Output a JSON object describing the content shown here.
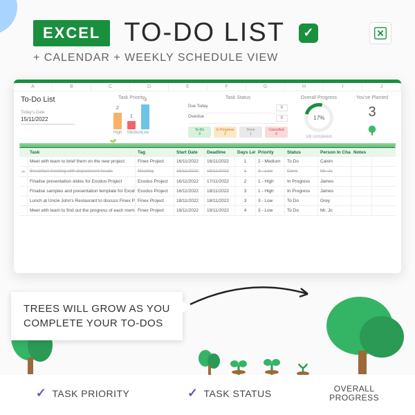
{
  "header": {
    "badge": "EXCEL",
    "title": "TO-DO LIST",
    "subtitle": "+ CALENDAR + WEEKLY SCHEDULE VIEW"
  },
  "sheet": {
    "title": "To-Do List",
    "columns_letters": [
      "A",
      "B",
      "C",
      "D",
      "E",
      "F",
      "G",
      "H",
      "I",
      "J"
    ],
    "priority_card": {
      "title": "Task Priority",
      "bars": [
        {
          "label": "High",
          "value": 2,
          "color": "#f7b267"
        },
        {
          "label": "Medium",
          "value": 1,
          "color": "#f06767"
        },
        {
          "label": "Low",
          "value": 3,
          "color": "#6cc4e8"
        }
      ]
    },
    "today": {
      "label": "Today's Date",
      "value": "15/11/2022"
    },
    "status_card": {
      "title": "Task Status",
      "rows": [
        {
          "label": "Due Today",
          "value": 0
        },
        {
          "label": "Overdue",
          "value": 0
        }
      ],
      "pills": [
        {
          "label": "To-Do",
          "value": 3,
          "bg": "#d6f1dc",
          "fg": "#1a8f3e"
        },
        {
          "label": "In Progress",
          "value": 2,
          "bg": "#fde7c9",
          "fg": "#c97a12"
        },
        {
          "label": "Done",
          "value": 1,
          "bg": "#e9e9e9",
          "fg": "#888"
        },
        {
          "label": "Cancelled",
          "value": 0,
          "bg": "#fcd9d9",
          "fg": "#c94545"
        }
      ]
    },
    "progress": {
      "title": "Overall Progress",
      "pct": "17%",
      "sub": "1/6 completed"
    },
    "planted": {
      "title": "You've Planted",
      "value": "3"
    },
    "table": {
      "headers": [
        "",
        "Task",
        "Tag",
        "Start Date",
        "Deadline",
        "Days Left",
        "Priority",
        "Status",
        "Person In Charge",
        "Notes"
      ],
      "rows": [
        {
          "done": false,
          "task": "Meet with team to brief them on the new project.",
          "tag": "Finex Project",
          "start": "16/11/2022",
          "deadline": "16/11/2022",
          "days": "1",
          "priority": "2 - Medium",
          "status": "To Do",
          "pic": "Calvin"
        },
        {
          "done": true,
          "task": "Breakfast meeting with department heads",
          "tag": "Meeting",
          "start": "16/11/2022",
          "deadline": "16/11/2022",
          "days": "1",
          "priority": "3 - Low",
          "status": "Done",
          "pic": "Mr. Jo"
        },
        {
          "done": false,
          "task": "Finalise presentation slides for Exodus Project",
          "tag": "Exodus Project",
          "start": "16/11/2022",
          "deadline": "17/11/2022",
          "days": "2",
          "priority": "1 - High",
          "status": "In Progress",
          "pic": "James"
        },
        {
          "done": false,
          "task": "Finalise samples and presentation template for Exodus Project",
          "tag": "Exodus Project",
          "start": "16/11/2022",
          "deadline": "18/11/2022",
          "days": "3",
          "priority": "1 - High",
          "status": "In Progress",
          "pic": "James"
        },
        {
          "done": false,
          "task": "Lunch at Uncle John's Restaurant to discuss Finex Project",
          "tag": "Finex Project",
          "start": "18/11/2022",
          "deadline": "18/11/2022",
          "days": "3",
          "priority": "3 - Low",
          "status": "To Do",
          "pic": "Grey"
        },
        {
          "done": false,
          "task": "Meet with team to find out the progress of each member",
          "tag": "Finex Project",
          "start": "19/11/2022",
          "deadline": "19/11/2022",
          "days": "4",
          "priority": "3 - Low",
          "status": "To Do",
          "pic": "Mr. Jo"
        }
      ]
    }
  },
  "callout": {
    "l1": "TREES WILL GROW AS YOU",
    "l2": "COMPLETE YOUR TO-DOS"
  },
  "footer": {
    "items": [
      "TASK PRIORITY",
      "TASK STATUS"
    ],
    "last": {
      "l1": "OVERALL",
      "l2": "PROGRESS"
    }
  }
}
